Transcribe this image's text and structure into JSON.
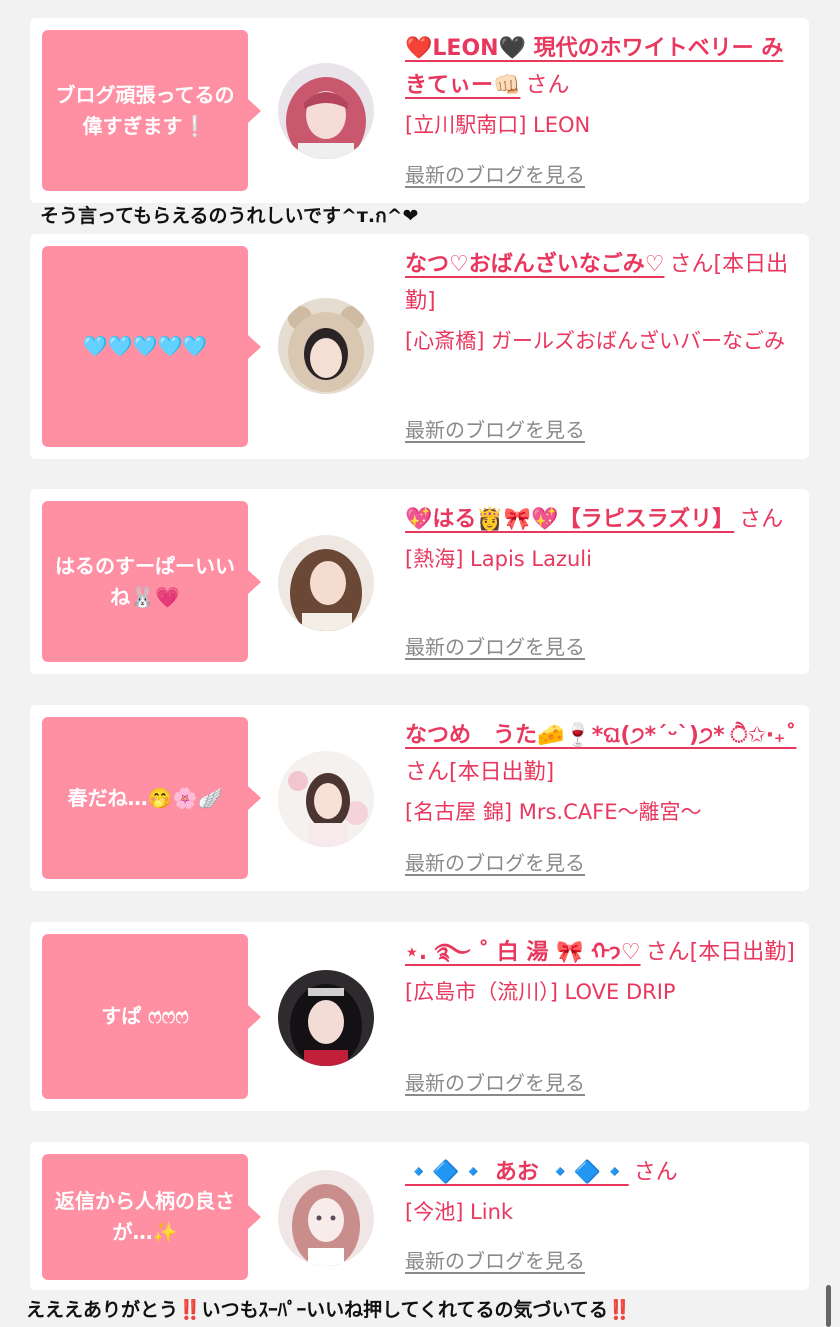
{
  "cards": [
    {
      "message": "ブログ頑張ってるの偉すぎます❕",
      "name": "❤️LEON🖤 現代のホワイトベリー みきてぃー👊🏻",
      "san": "さん",
      "shop": "[立川駅南口] LEON",
      "blog_link": "最新のブログを見る",
      "avatar_icon": "girl-pink-hair-avatar"
    },
    {
      "message": "🩵🩵🩵🩵🩵",
      "name": "なつ♡おばんざいなごみ♡",
      "san": "さん[本日出勤]",
      "shop": "[心斎橋] ガールズおばんざいバーなごみ",
      "blog_link": "最新のブログを見る",
      "avatar_icon": "girl-bear-hood-avatar"
    },
    {
      "message": "はるのすーぱーいいね🐰💗",
      "name": "💖はる👸🎀💖【ラピスラズリ】",
      "san": "さん",
      "shop": "[熱海] Lapis Lazuli",
      "blog_link": "最新のブログを見る",
      "avatar_icon": "girl-long-hair-avatar"
    },
    {
      "message": "春だね…🤭🌸🪽",
      "name": "なつめ　うた🧀🍷*ଘ(੭*ˊᵕˋ)੭* ੈ✩‧₊˚",
      "san": "さん[本日出勤]",
      "shop": "[名古屋 錦] Mrs.CAFE〜離宮〜",
      "blog_link": "最新のブログを見る",
      "avatar_icon": "girl-flowers-avatar"
    },
    {
      "message": "すぱ ෆ̇ෆ̇ෆ̇",
      "name": "⋆. ࿐ ˚ 白 湯 🎀 ᡣ𐭩♡",
      "san": "さん[本日出勤]",
      "shop": "[広島市（流川）] LOVE DRIP",
      "blog_link": "最新のブログを見る",
      "avatar_icon": "girl-black-hair-avatar"
    },
    {
      "message": "返信から人柄の良さが…✨",
      "name": "🔹🔷🔹 あお 🔹🔷🔹",
      "san": "さん",
      "shop": "[今池] Link",
      "blog_link": "最新のブログを見る",
      "avatar_icon": "illustrated-girl-avatar"
    }
  ],
  "captions": {
    "first": "そう言ってもらえるのうれしいです^т.ก^❤︎",
    "second": "えええありがとう‼️いつもｽｰﾊﾟｰいいね押してくれてるの気づいてる‼️"
  },
  "colors": {
    "accent": "#e8385e",
    "bubble": "#ff8fa3",
    "background": "#f2f2f2"
  }
}
